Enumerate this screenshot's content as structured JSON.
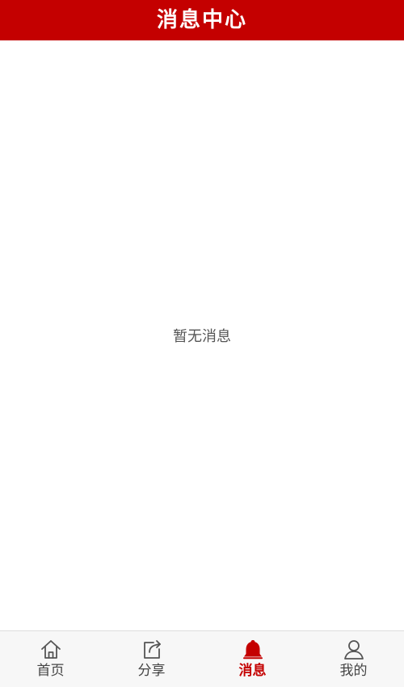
{
  "header": {
    "title": "消息中心"
  },
  "content": {
    "empty_text": "暂无消息"
  },
  "tabbar": {
    "items": [
      {
        "label": "首页",
        "icon": "home-icon"
      },
      {
        "label": "分享",
        "icon": "share-icon"
      },
      {
        "label": "消息",
        "icon": "bell-icon"
      },
      {
        "label": "我的",
        "icon": "user-icon"
      }
    ],
    "active": "消息"
  },
  "colors": {
    "accent": "#c40000",
    "text": "#444444",
    "muted": "#555555",
    "tabbar_bg": "#f7f7f7"
  }
}
